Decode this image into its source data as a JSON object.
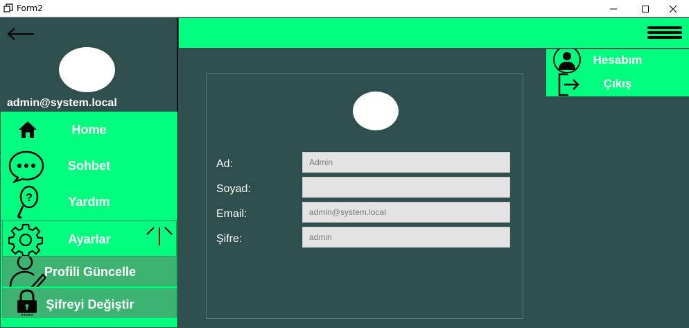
{
  "window": {
    "title": "Form2",
    "icon": "window-restore-icon",
    "controls": [
      "minimize-icon",
      "maximize-icon",
      "close-icon"
    ]
  },
  "sidebar": {
    "back_icon": "arrow-left-icon",
    "avatar": "avatar",
    "email": "admin@system.local",
    "items": [
      {
        "label": "Home",
        "icon": "home-icon"
      },
      {
        "label": "Sohbet",
        "icon": "chat-bubble-icon"
      },
      {
        "label": "Yardım",
        "icon": "help-icon"
      },
      {
        "label": "Ayarlar",
        "icon": "gear-icon",
        "expand_icon": "collapse-arrows-icon"
      }
    ],
    "sub_items": [
      {
        "label": "Profili Güncelle",
        "icon": "user-edit-icon"
      },
      {
        "label": "Şifreyi Değiştir",
        "icon": "lock-icon"
      }
    ]
  },
  "topbar": {
    "menu_icon": "hamburger-icon"
  },
  "account_menu": {
    "items": [
      {
        "label": "Hesabım",
        "icon": "user-icon"
      },
      {
        "label": "Çıkış",
        "icon": "logout-icon"
      }
    ]
  },
  "profile_form": {
    "fields": [
      {
        "label": "Ad:",
        "value": "Admin"
      },
      {
        "label": "Soyad:",
        "value": ""
      },
      {
        "label": "Email:",
        "value": "admin@system.local"
      },
      {
        "label": "Şifre:",
        "value": "admin"
      }
    ]
  },
  "colors": {
    "accent_green": "#00ff7f",
    "sub_item_green": "#3cb371",
    "background": "#2f4f4f",
    "input_bg": "#e3e3e3"
  }
}
